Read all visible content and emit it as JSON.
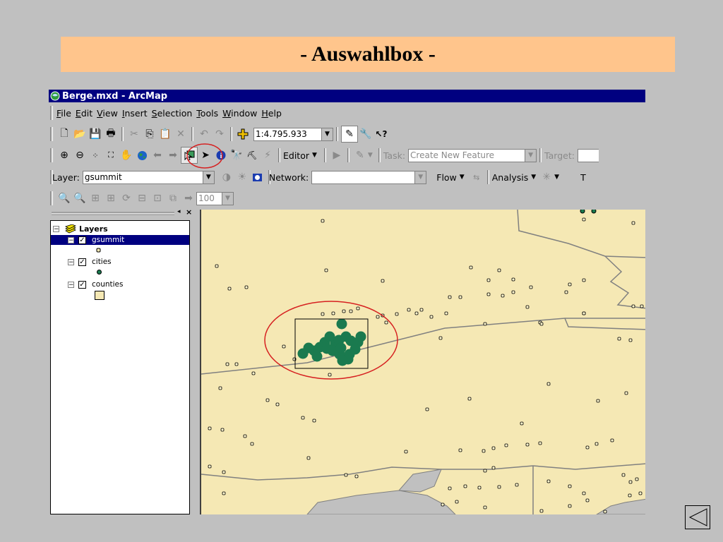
{
  "slide": {
    "title": "- Auswahlbox -"
  },
  "window": {
    "title": "Berge.mxd - ArcMap"
  },
  "menu": [
    "File",
    "Edit",
    "View",
    "Insert",
    "Selection",
    "Tools",
    "Window",
    "Help"
  ],
  "standard_toolbar": {
    "scale": "1:4.795.933"
  },
  "editor_toolbar": {
    "editor_label": "Editor",
    "task_label": "Task:",
    "task_value": "Create New Feature",
    "target_label": "Target:"
  },
  "layer_toolbar": {
    "layer_label": "Layer:",
    "layer_value": "gsummit",
    "network_label": "Network:",
    "flow_label": "Flow",
    "analysis_label": "Analysis",
    "t_label": "T"
  },
  "bottom_toolbar": {
    "zoom_value": "100"
  },
  "toc": {
    "root": "Layers",
    "layers": [
      {
        "name": "gsummit",
        "checked": true,
        "selected": true
      },
      {
        "name": "cities",
        "checked": true,
        "selected": false
      },
      {
        "name": "counties",
        "checked": true,
        "selected": false
      }
    ]
  },
  "colors": {
    "title_band": "#ffc58c",
    "titlebar": "#000080",
    "map_fill": "#f5e8b4",
    "selected_feature": "#1a7a4f",
    "highlight_ring": "#d62020"
  }
}
